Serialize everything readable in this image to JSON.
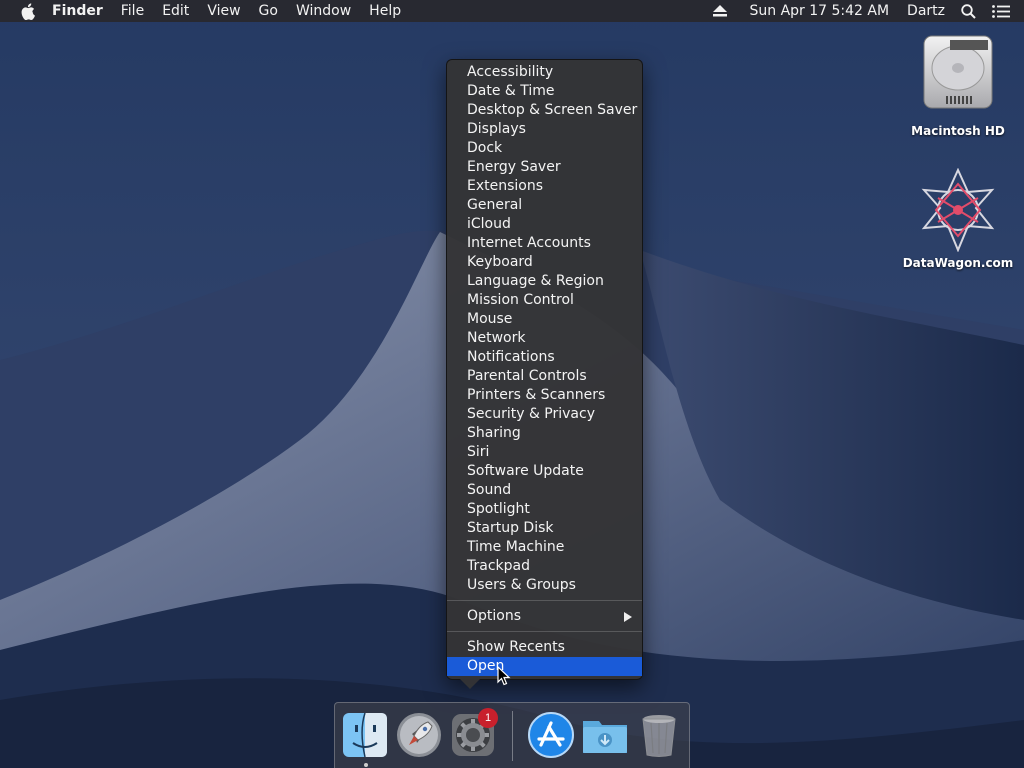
{
  "menubar": {
    "app_name": "Finder",
    "items": [
      "File",
      "Edit",
      "View",
      "Go",
      "Window",
      "Help"
    ],
    "datetime": "Sun Apr 17  5:42 AM",
    "user": "Dartz"
  },
  "desktop": {
    "icons": [
      {
        "label": "Macintosh HD",
        "icon": "hard-drive-icon"
      },
      {
        "label": "DataWagon.com",
        "icon": "network-star-icon"
      }
    ]
  },
  "context_menu": {
    "items": [
      "Accessibility",
      "Date & Time",
      "Desktop & Screen Saver",
      "Displays",
      "Dock",
      "Energy Saver",
      "Extensions",
      "General",
      "iCloud",
      "Internet Accounts",
      "Keyboard",
      "Language & Region",
      "Mission Control",
      "Mouse",
      "Network",
      "Notifications",
      "Parental Controls",
      "Printers & Scanners",
      "Security & Privacy",
      "Sharing",
      "Siri",
      "Software Update",
      "Sound",
      "Spotlight",
      "Startup Disk",
      "Time Machine",
      "Trackpad",
      "Users & Groups"
    ],
    "options_label": "Options",
    "show_recents_label": "Show Recents",
    "open_label": "Open",
    "highlight_color": "#1a5bd8"
  },
  "dock": {
    "items": [
      "finder-icon",
      "launchpad-icon",
      "system-preferences-icon",
      "app-store-icon",
      "downloads-folder-icon",
      "trash-icon"
    ],
    "badge_count": "1",
    "badge_color": "#c8202c"
  }
}
